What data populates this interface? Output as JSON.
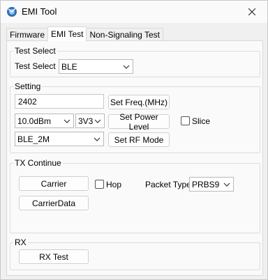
{
  "window": {
    "title": "EMI Tool"
  },
  "tabs": [
    {
      "label": "Firmware"
    },
    {
      "label": "EMI Test"
    },
    {
      "label": "Non-Signaling Test"
    }
  ],
  "test_select": {
    "group_title": "Test Select",
    "label": "Test Select",
    "value": "BLE"
  },
  "setting": {
    "group_title": "Setting",
    "freq_value": "2402",
    "set_freq_label": "Set Freq.(MHz)",
    "power_value": "10.0dBm",
    "voltage_value": "3V3",
    "set_power_label": "Set Power Level",
    "slice_label": "Slice",
    "rf_mode_value": "BLE_2M",
    "set_rf_mode_label": "Set RF Mode"
  },
  "tx_continue": {
    "group_title": "TX Continue",
    "carrier_label": "Carrier",
    "hop_label": "Hop",
    "packet_type_label": "Packet Type",
    "packet_type_value": "PRBS9",
    "carrier_data_label": "CarrierData"
  },
  "rx": {
    "group_title": "RX",
    "rx_test_label": "RX Test"
  }
}
